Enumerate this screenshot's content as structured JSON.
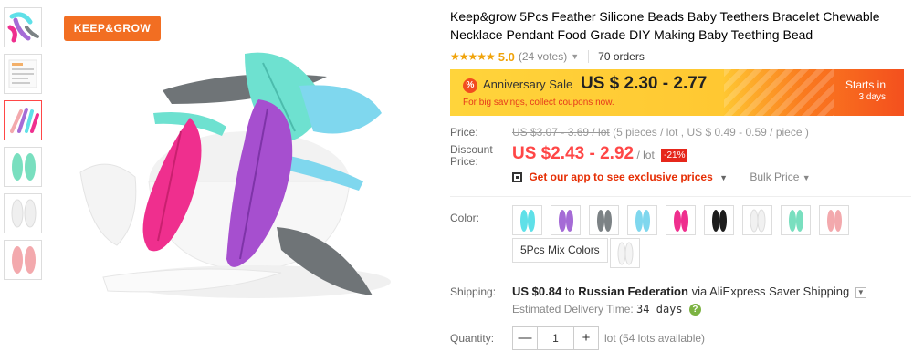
{
  "brand": {
    "logo_text": "KEEP&GROW"
  },
  "product": {
    "title": "Keep&grow 5Pcs Feather Silicone Beads Baby Teethers Bracelet Chewable Necklace Pendant Food Grade DIY Making Baby Teething Bead",
    "stars": "★★★★★",
    "rating": "5.0",
    "votes": "(24 votes)",
    "orders": "70 orders"
  },
  "sale": {
    "icon": "%",
    "name": "Anniversary Sale",
    "price": "US $ 2.30 - 2.77",
    "subtext": "For big savings, collect coupons now.",
    "starts_label": "Starts in",
    "starts_value": "3 days"
  },
  "price": {
    "label": "Price:",
    "original": "US $3.07 - 3.69 / lot",
    "details": "(5 pieces / lot , US $ 0.49 - 0.59 / piece )"
  },
  "discount": {
    "label": "Discount Price:",
    "value": "US $2.43 - 2.92",
    "unit": "/ lot",
    "badge": "-21%",
    "app_link": "Get our app to see exclusive prices",
    "bulk": "Bulk Price"
  },
  "color": {
    "label": "Color:",
    "swatches": [
      {
        "name": "aqua",
        "hex": "#5fe0e8"
      },
      {
        "name": "purple",
        "hex": "#a56bd6"
      },
      {
        "name": "gray",
        "hex": "#7c8285"
      },
      {
        "name": "light-blue",
        "hex": "#7fd7ee"
      },
      {
        "name": "pink",
        "hex": "#ef2f8e"
      },
      {
        "name": "black",
        "hex": "#1d1d1d"
      },
      {
        "name": "white",
        "hex": "#f1f1f1"
      },
      {
        "name": "mint",
        "hex": "#79dfbf"
      },
      {
        "name": "light-pink",
        "hex": "#f3a9ad"
      }
    ],
    "mix_label": "5Pcs Mix Colors",
    "extra_swatch": {
      "name": "white",
      "hex": "#f4f4f4"
    }
  },
  "shipping": {
    "label": "Shipping:",
    "price": "US $0.84",
    "to": "to",
    "country": "Russian Federation",
    "via": "via AliExpress Saver Shipping",
    "delivery_label": "Estimated Delivery Time:",
    "delivery_value": "34 days",
    "help_icon": "?"
  },
  "quantity": {
    "label": "Quantity:",
    "minus": "—",
    "value": "1",
    "plus": "+",
    "unit": "lot (54 lots available)"
  },
  "colors": {
    "accent": "#ff4747",
    "star": "#f0a30a",
    "logo": "#f26e22"
  }
}
